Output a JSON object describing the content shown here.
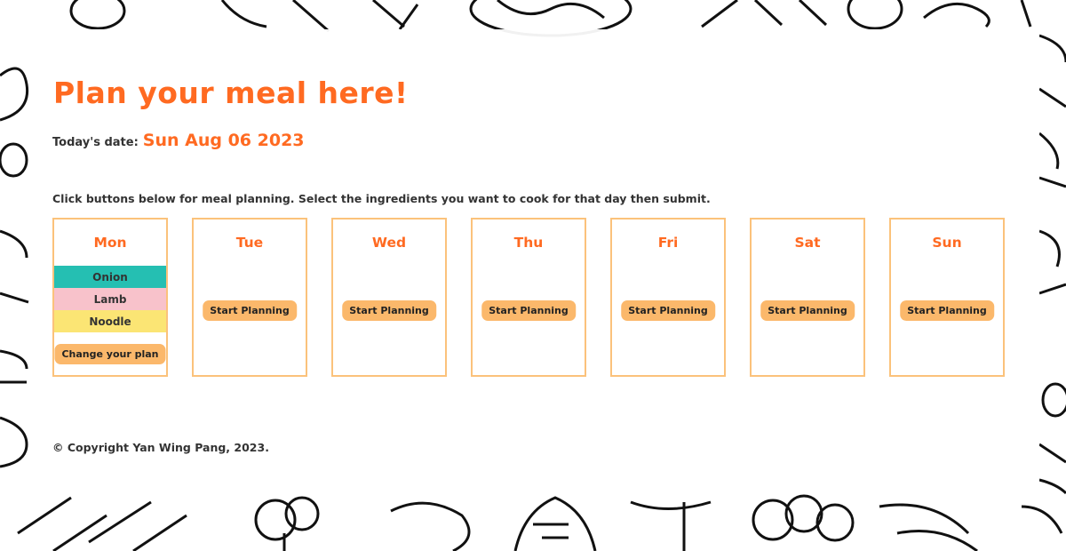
{
  "page": {
    "title": "Plan your meal here!",
    "date_label": "Today's date:",
    "date_value": "Sun Aug 06 2023",
    "instructions": "Click buttons below for meal planning. Select the ingredients you want to cook for that day then submit.",
    "footer": "© Copyright Yan Wing Pang, 2023."
  },
  "days": [
    {
      "name": "Mon",
      "ingredients": [
        "Onion",
        "Lamb",
        "Noodle"
      ],
      "button": "Change your plan"
    },
    {
      "name": "Tue",
      "button": "Start Planning"
    },
    {
      "name": "Wed",
      "button": "Start Planning"
    },
    {
      "name": "Thu",
      "button": "Start Planning"
    },
    {
      "name": "Fri",
      "button": "Start Planning"
    },
    {
      "name": "Sat",
      "button": "Start Planning"
    },
    {
      "name": "Sun",
      "button": "Start Planning"
    }
  ],
  "colors": {
    "accent": "#ff6a21",
    "card_border": "#fbc27b",
    "button": "#fbb86b",
    "ingredient_onion": "#25bfb2",
    "ingredient_lamb": "#f8c2cb",
    "ingredient_noodle": "#fbe574"
  }
}
